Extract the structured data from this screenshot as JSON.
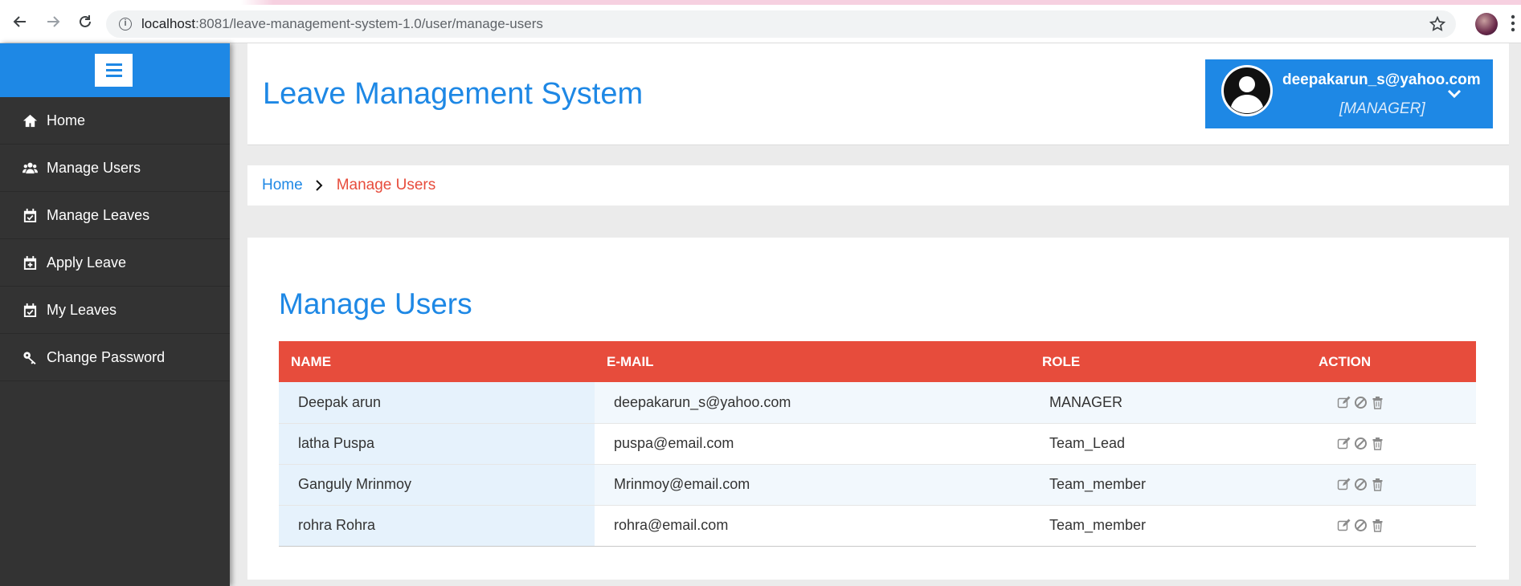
{
  "browser": {
    "url_host": "localhost",
    "url_rest": ":8081/leave-management-system-1.0/user/manage-users"
  },
  "sidebar": {
    "items": [
      {
        "label": "Home",
        "icon": "home-icon"
      },
      {
        "label": "Manage Users",
        "icon": "users-icon"
      },
      {
        "label": "Manage Leaves",
        "icon": "calendar-check-icon"
      },
      {
        "label": "Apply Leave",
        "icon": "calendar-plus-icon"
      },
      {
        "label": "My Leaves",
        "icon": "calendar-check-icon"
      },
      {
        "label": "Change Password",
        "icon": "key-icon"
      }
    ]
  },
  "header": {
    "title": "Leave Management System",
    "user_email": "deepakarun_s@yahoo.com",
    "user_role": "[MANAGER]"
  },
  "breadcrumb": {
    "home": "Home",
    "current": "Manage Users"
  },
  "main": {
    "title": "Manage Users",
    "table": {
      "headers": [
        "NAME",
        "E-MAIL",
        "ROLE",
        "ACTION"
      ],
      "rows": [
        {
          "name": "Deepak arun",
          "email": "deepakarun_s@yahoo.com",
          "role": "MANAGER"
        },
        {
          "name": "latha Puspa",
          "email": "puspa@email.com",
          "role": "Team_Lead"
        },
        {
          "name": "Ganguly Mrinmoy",
          "email": "Mrinmoy@email.com",
          "role": "Team_member"
        },
        {
          "name": "rohra Rohra",
          "email": "rohra@email.com",
          "role": "Team_member"
        }
      ],
      "action_icons": [
        "edit-icon",
        "block-icon",
        "trash-icon"
      ]
    }
  },
  "colors": {
    "primary": "#1e88e5",
    "accent": "#e74c3c",
    "sidebar_bg": "#333333"
  }
}
